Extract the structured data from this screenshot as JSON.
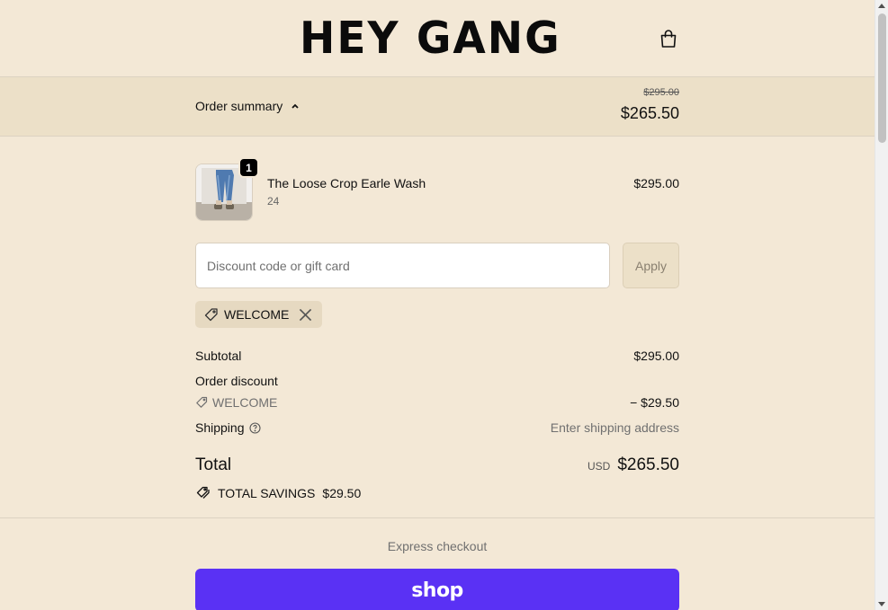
{
  "header": {
    "logo": "HEY GANG",
    "cart_icon": "shopping-bag-icon"
  },
  "summary": {
    "toggle_label": "Order summary",
    "original_price": "$295.00",
    "discounted_price": "$265.50"
  },
  "line_item": {
    "quantity": "1",
    "name": "The Loose Crop Earle Wash",
    "variant": "24",
    "price": "$295.00"
  },
  "discount": {
    "placeholder": "Discount code or gift card",
    "apply_label": "Apply",
    "applied_code": "WELCOME"
  },
  "totals": {
    "subtotal_label": "Subtotal",
    "subtotal_value": "$295.00",
    "order_discount_label": "Order discount",
    "discount_code": "WELCOME",
    "discount_value": "− $29.50",
    "shipping_label": "Shipping",
    "shipping_value": "Enter shipping address",
    "total_label": "Total",
    "currency": "USD",
    "total_value": "$265.50",
    "savings_label": "TOTAL SAVINGS",
    "savings_value": "$29.50"
  },
  "checkout": {
    "express_label": "Express checkout",
    "shop_pay_label": "shop"
  },
  "colors": {
    "background": "#f3e8d6",
    "summary_bar": "#ece0c8",
    "shop_pay": "#5a31f4"
  }
}
